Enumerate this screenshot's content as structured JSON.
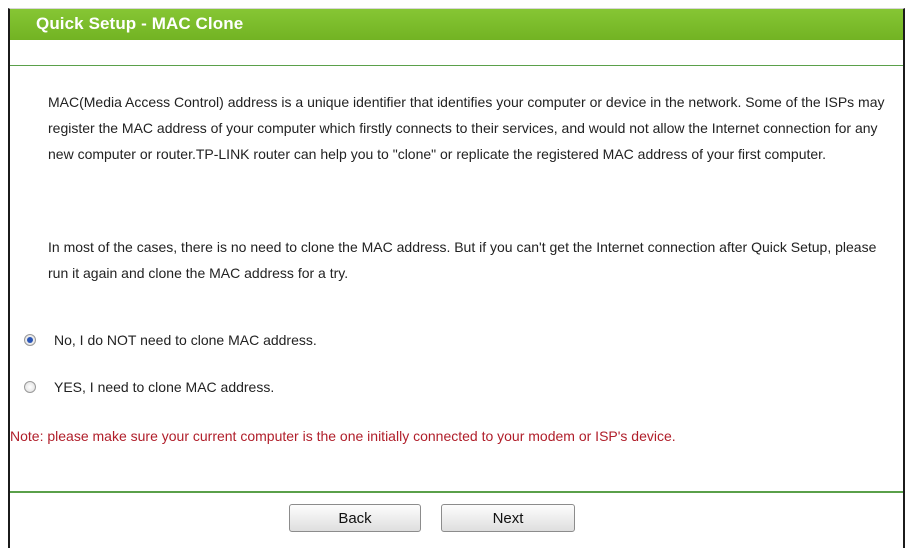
{
  "header": {
    "title": "Quick Setup - MAC Clone"
  },
  "intro": "MAC(Media Access Control) address is a unique identifier that identifies your computer or device in the network. Some of the ISPs may register the MAC address of your computer which firstly connects to their services, and would not allow the Internet connection for any new computer or router.TP-LINK router can help you to \"clone\" or replicate the registered MAC address of your first computer.",
  "advice": "In most of the cases, there is no need to clone the MAC address. But if you can't get the Internet connection after Quick Setup, please run it again and clone the MAC address for a try.",
  "options": [
    {
      "label": "No, I do NOT need to clone MAC address.",
      "selected": true
    },
    {
      "label": "YES, I need to clone MAC address.",
      "selected": false
    }
  ],
  "note": "Note: please make sure your current computer is the one initially connected to your modem or ISP's device.",
  "buttons": {
    "back": "Back",
    "next": "Next"
  },
  "colors": {
    "header": "#7fbe2e",
    "note": "#b01e2a",
    "rule": "#5aa04a"
  }
}
